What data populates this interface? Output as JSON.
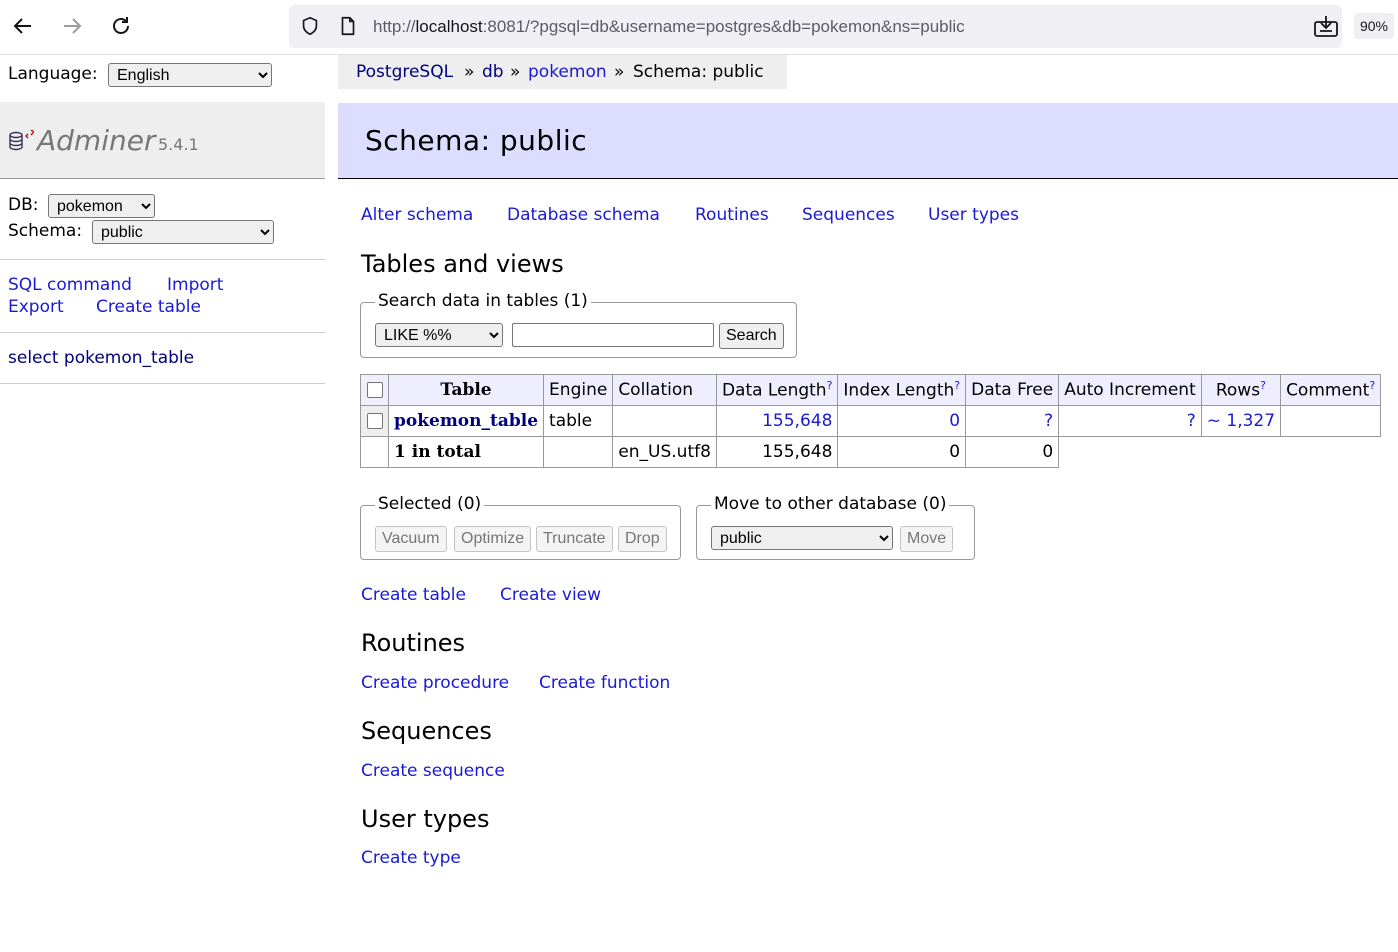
{
  "browser": {
    "url_prefix": "http://",
    "url_host": "localhost",
    "url_rest": ":8081/?pgsql=db&username=postgres&db=pokemon&ns=public",
    "zoom": "90%"
  },
  "sidebar": {
    "language_label": "Language:",
    "language_value": "English",
    "app_name": "Adminer",
    "version": "5.4.1",
    "db_label": "DB:",
    "db_value": "pokemon",
    "schema_label": "Schema:",
    "schema_value": "public",
    "links": {
      "sql_command": "SQL command",
      "import": "Import",
      "export": "Export",
      "create_table": "Create table"
    },
    "tables": [
      "select pokemon_table"
    ]
  },
  "breadcrumb": {
    "items": [
      "PostgreSQL",
      "db",
      "pokemon"
    ],
    "separator": "»",
    "current": "Schema: public"
  },
  "page_title": "Schema: public",
  "schema_links": [
    "Alter schema",
    "Database schema",
    "Routines",
    "Sequences",
    "User types"
  ],
  "tables_section": {
    "title": "Tables and views",
    "search_legend": "Search data in tables (1)",
    "search_operator": "LIKE %%",
    "search_value": "",
    "search_button": "Search",
    "columns": [
      "Table",
      "Engine",
      "Collation",
      "Data Length",
      "Index Length",
      "Data Free",
      "Auto Increment",
      "Rows",
      "Comment"
    ],
    "help_mark": "?",
    "rows": [
      {
        "name": "pokemon_table",
        "engine": "table",
        "collation": "",
        "data_length": "155,648",
        "index_length": "0",
        "data_free": "?",
        "auto_increment": "?",
        "rows": "~ 1,327",
        "comment": ""
      }
    ],
    "total": {
      "label": "1 in total",
      "collation": "en_US.utf8",
      "data_length": "155,648",
      "index_length": "0",
      "data_free": "0"
    }
  },
  "selected_box": {
    "legend": "Selected (0)",
    "buttons": [
      "Vacuum",
      "Optimize",
      "Truncate",
      "Drop"
    ]
  },
  "move_box": {
    "legend": "Move to other database (0)",
    "select_value": "public",
    "button": "Move"
  },
  "create_links": [
    "Create table",
    "Create view"
  ],
  "routines": {
    "title": "Routines",
    "links": [
      "Create procedure",
      "Create function"
    ]
  },
  "sequences": {
    "title": "Sequences",
    "link": "Create sequence"
  },
  "user_types": {
    "title": "User types",
    "link": "Create type"
  }
}
